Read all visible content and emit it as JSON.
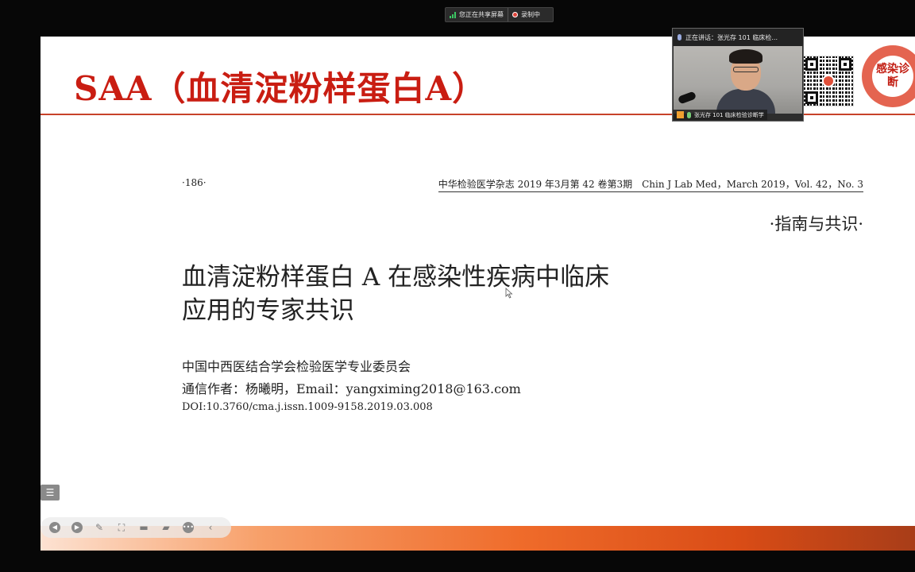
{
  "share_bar": {
    "sharing_label": "您正在共享屏幕",
    "recording_label": "录制中"
  },
  "slide": {
    "title": "SAA（血清淀粉样蛋白A）",
    "brand_logo_text": "感染诊断"
  },
  "document": {
    "page_number": "·186·",
    "journal_line": "中华检验医学杂志 2019 年3月第 42 卷第3期　Chin J Lab Med，March 2019，Vol. 42，No. 3",
    "section": "·指南与共识·",
    "title_line1": "血清淀粉样蛋白 A 在感染性疾病中临床",
    "title_line2": "应用的专家共识",
    "organization": "中国中西医结合学会检验医学专业委员会",
    "correspondence": "通信作者：杨曦明，Email：yangximing2018@163.com",
    "doi": "DOI:10.3760/cma.j.issn.1009-9158.2019.03.008"
  },
  "video": {
    "speaking_label": "正在讲话：张光存 101  临床检...",
    "name_label": "张光存 101  临床检验诊断学"
  },
  "toolbar": {
    "icons": [
      "prev-icon",
      "next-icon",
      "pen-icon",
      "screenshot-icon",
      "video-icon",
      "chat-icon",
      "more-icon",
      "collapse-icon"
    ]
  },
  "colors": {
    "title_red": "#c91d12",
    "accent_orange": "#ef6b2a",
    "background": "#070707"
  }
}
